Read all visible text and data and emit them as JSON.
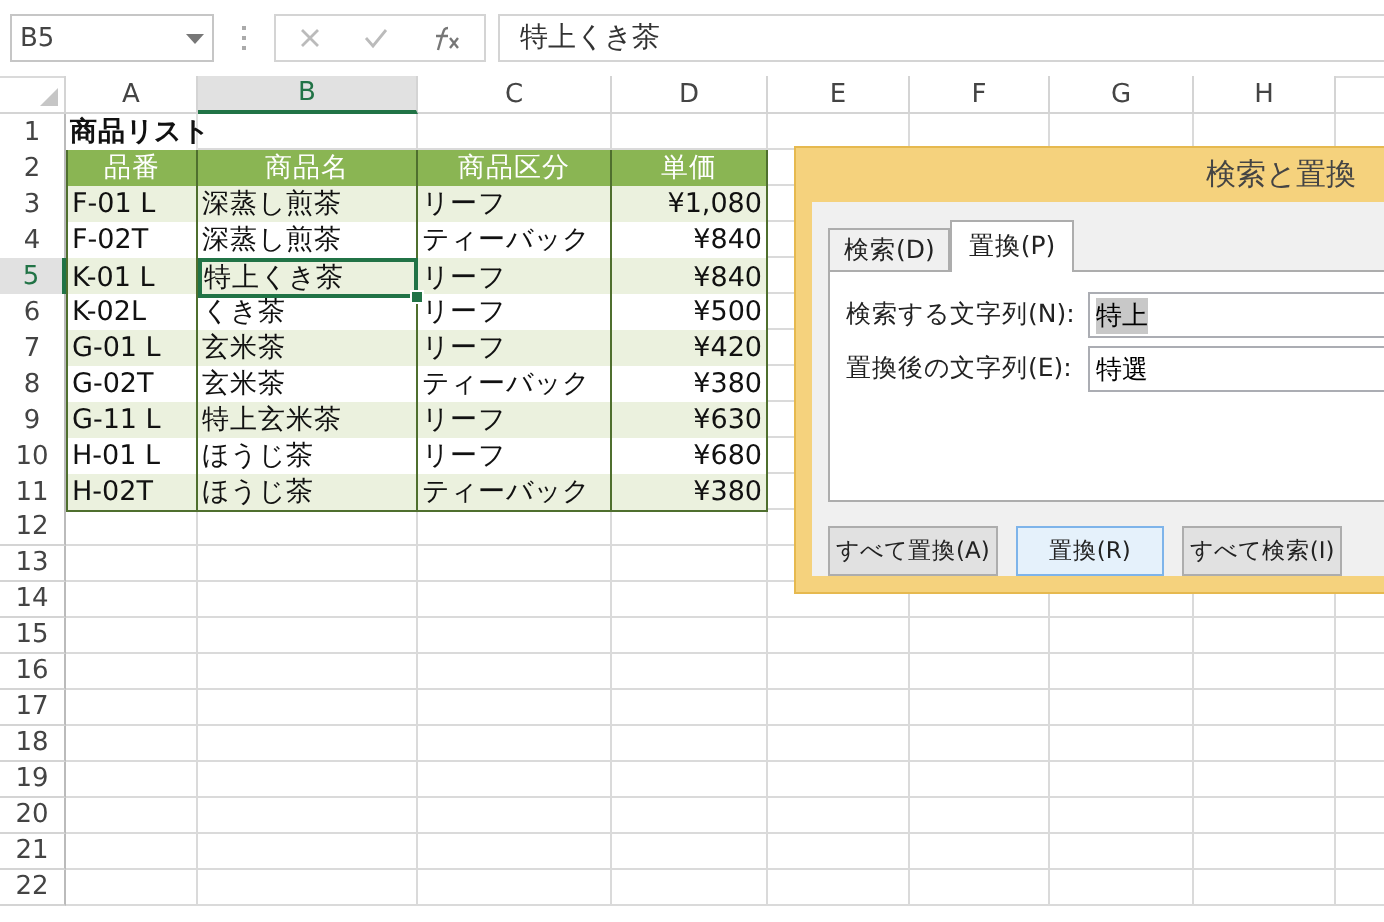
{
  "formula_bar": {
    "name_box": "B5",
    "value": "特上くき茶"
  },
  "sheet": {
    "columns": [
      {
        "label": "A",
        "selected": false
      },
      {
        "label": "B",
        "selected": true
      },
      {
        "label": "C",
        "selected": false
      },
      {
        "label": "D",
        "selected": false
      },
      {
        "label": "E",
        "selected": false
      },
      {
        "label": "F",
        "selected": false
      },
      {
        "label": "G",
        "selected": false
      },
      {
        "label": "H",
        "selected": false
      }
    ],
    "rows": [
      {
        "kind": "title",
        "number": "1",
        "selected": false,
        "cells": [
          {
            "text": "商品リスト",
            "active": false
          }
        ]
      },
      {
        "kind": "header",
        "number": "2",
        "selected": false,
        "cells": [
          {
            "text": "品番",
            "active": false
          },
          {
            "text": "商品名",
            "active": false
          },
          {
            "text": "商品区分",
            "active": false
          },
          {
            "text": "単価",
            "active": false
          }
        ]
      },
      {
        "kind": "data",
        "number": "3",
        "selected": false,
        "banded": true,
        "cells": [
          {
            "text": "F-01 L",
            "active": false
          },
          {
            "text": "深蒸し煎茶",
            "active": false
          },
          {
            "text": "リーフ",
            "active": false
          },
          {
            "text": "¥1,080",
            "active": false
          }
        ]
      },
      {
        "kind": "data",
        "number": "4",
        "selected": false,
        "banded": false,
        "cells": [
          {
            "text": "F-02T",
            "active": false
          },
          {
            "text": "深蒸し煎茶",
            "active": false
          },
          {
            "text": "ティーバック",
            "active": false
          },
          {
            "text": "¥840",
            "active": false
          }
        ]
      },
      {
        "kind": "data",
        "number": "5",
        "selected": true,
        "banded": true,
        "cells": [
          {
            "text": "K-01 L",
            "active": false
          },
          {
            "text": "特上くき茶",
            "active": true
          },
          {
            "text": "リーフ",
            "active": false
          },
          {
            "text": "¥840",
            "active": false
          }
        ]
      },
      {
        "kind": "data",
        "number": "6",
        "selected": false,
        "banded": false,
        "cells": [
          {
            "text": "K-02L",
            "active": false
          },
          {
            "text": "くき茶",
            "active": false
          },
          {
            "text": "リーフ",
            "active": false
          },
          {
            "text": "¥500",
            "active": false
          }
        ]
      },
      {
        "kind": "data",
        "number": "7",
        "selected": false,
        "banded": true,
        "cells": [
          {
            "text": "G-01 L",
            "active": false
          },
          {
            "text": "玄米茶",
            "active": false
          },
          {
            "text": "リーフ",
            "active": false
          },
          {
            "text": "¥420",
            "active": false
          }
        ]
      },
      {
        "kind": "data",
        "number": "8",
        "selected": false,
        "banded": false,
        "cells": [
          {
            "text": "G-02T",
            "active": false
          },
          {
            "text": "玄米茶",
            "active": false
          },
          {
            "text": "ティーバック",
            "active": false
          },
          {
            "text": "¥380",
            "active": false
          }
        ]
      },
      {
        "kind": "data",
        "number": "9",
        "selected": false,
        "banded": true,
        "cells": [
          {
            "text": "G-11 L",
            "active": false
          },
          {
            "text": "特上玄米茶",
            "active": false
          },
          {
            "text": "リーフ",
            "active": false
          },
          {
            "text": "¥630",
            "active": false
          }
        ]
      },
      {
        "kind": "data",
        "number": "10",
        "selected": false,
        "banded": false,
        "cells": [
          {
            "text": "H-01 L",
            "active": false
          },
          {
            "text": "ほうじ茶",
            "active": false
          },
          {
            "text": "リーフ",
            "active": false
          },
          {
            "text": "¥680",
            "active": false
          }
        ]
      },
      {
        "kind": "data",
        "number": "11",
        "selected": false,
        "banded": true,
        "cells": [
          {
            "text": "H-02T",
            "active": false
          },
          {
            "text": "ほうじ茶",
            "active": false
          },
          {
            "text": "ティーバック",
            "active": false
          },
          {
            "text": "¥380",
            "active": false
          }
        ]
      },
      {
        "kind": "empty",
        "number": "12",
        "selected": false,
        "cells": []
      },
      {
        "kind": "empty",
        "number": "13",
        "selected": false,
        "cells": []
      },
      {
        "kind": "empty",
        "number": "14",
        "selected": false,
        "cells": []
      },
      {
        "kind": "empty",
        "number": "15",
        "selected": false,
        "cells": []
      },
      {
        "kind": "empty",
        "number": "16",
        "selected": false,
        "cells": []
      },
      {
        "kind": "empty",
        "number": "17",
        "selected": false,
        "cells": []
      },
      {
        "kind": "empty",
        "number": "18",
        "selected": false,
        "cells": []
      },
      {
        "kind": "empty",
        "number": "19",
        "selected": false,
        "cells": []
      },
      {
        "kind": "empty",
        "number": "20",
        "selected": false,
        "cells": []
      },
      {
        "kind": "empty",
        "number": "21",
        "selected": false,
        "cells": []
      },
      {
        "kind": "empty",
        "number": "22",
        "selected": false,
        "cells": []
      }
    ]
  },
  "dialog": {
    "title": "検索と置換",
    "tabs": [
      {
        "label": "検索(D)",
        "selected": false
      },
      {
        "label": "置換(P)",
        "selected": true
      }
    ],
    "fields": [
      {
        "label": "検索する文字列(N):",
        "value": "特上",
        "highlighted": true
      },
      {
        "label": "置換後の文字列(E):",
        "value": "特選",
        "highlighted": false
      }
    ],
    "buttons": [
      {
        "label": "すべて置換(A)",
        "focused": false
      },
      {
        "label": "置換(R)",
        "focused": true
      },
      {
        "label": "すべて検索(I)",
        "focused": false
      }
    ]
  }
}
